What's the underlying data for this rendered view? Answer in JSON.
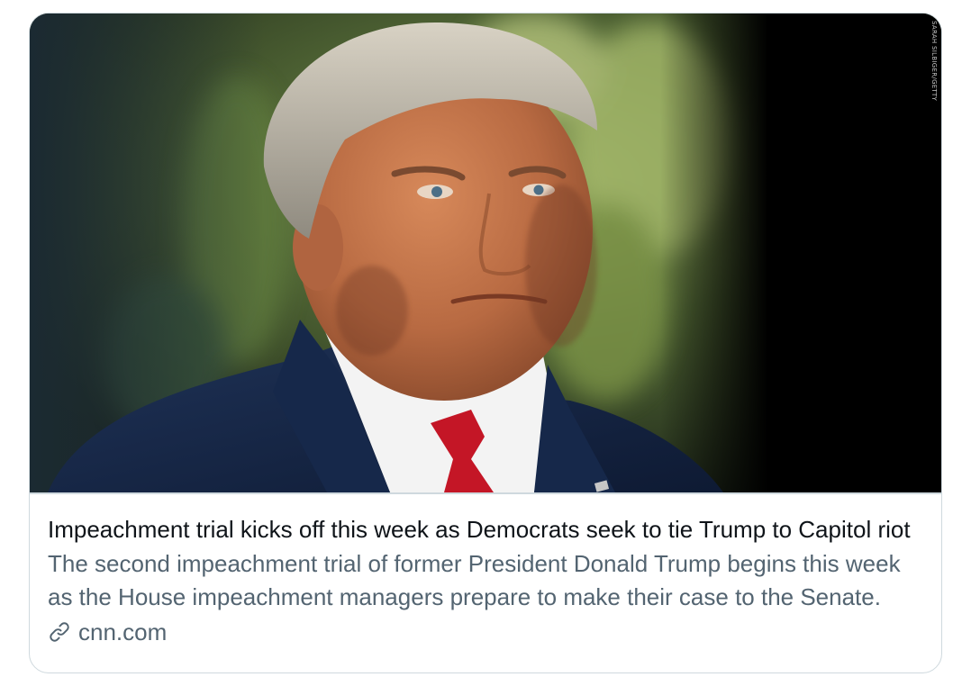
{
  "card": {
    "title": "Impeachment trial kicks off this week as Democrats seek to tie Trump to Capitol riot",
    "description": "The second impeachment trial of former President Donald Trump begins this week as the House impeachment managers prepare to make their case to the Senate.",
    "domain": "cnn.com",
    "domain_icon": "link-icon",
    "photo_credit": "SARAH SILBIGER/GETTY"
  },
  "colors": {
    "title": "#0f1419",
    "secondary_text": "#536471",
    "border": "#cfd9de"
  }
}
